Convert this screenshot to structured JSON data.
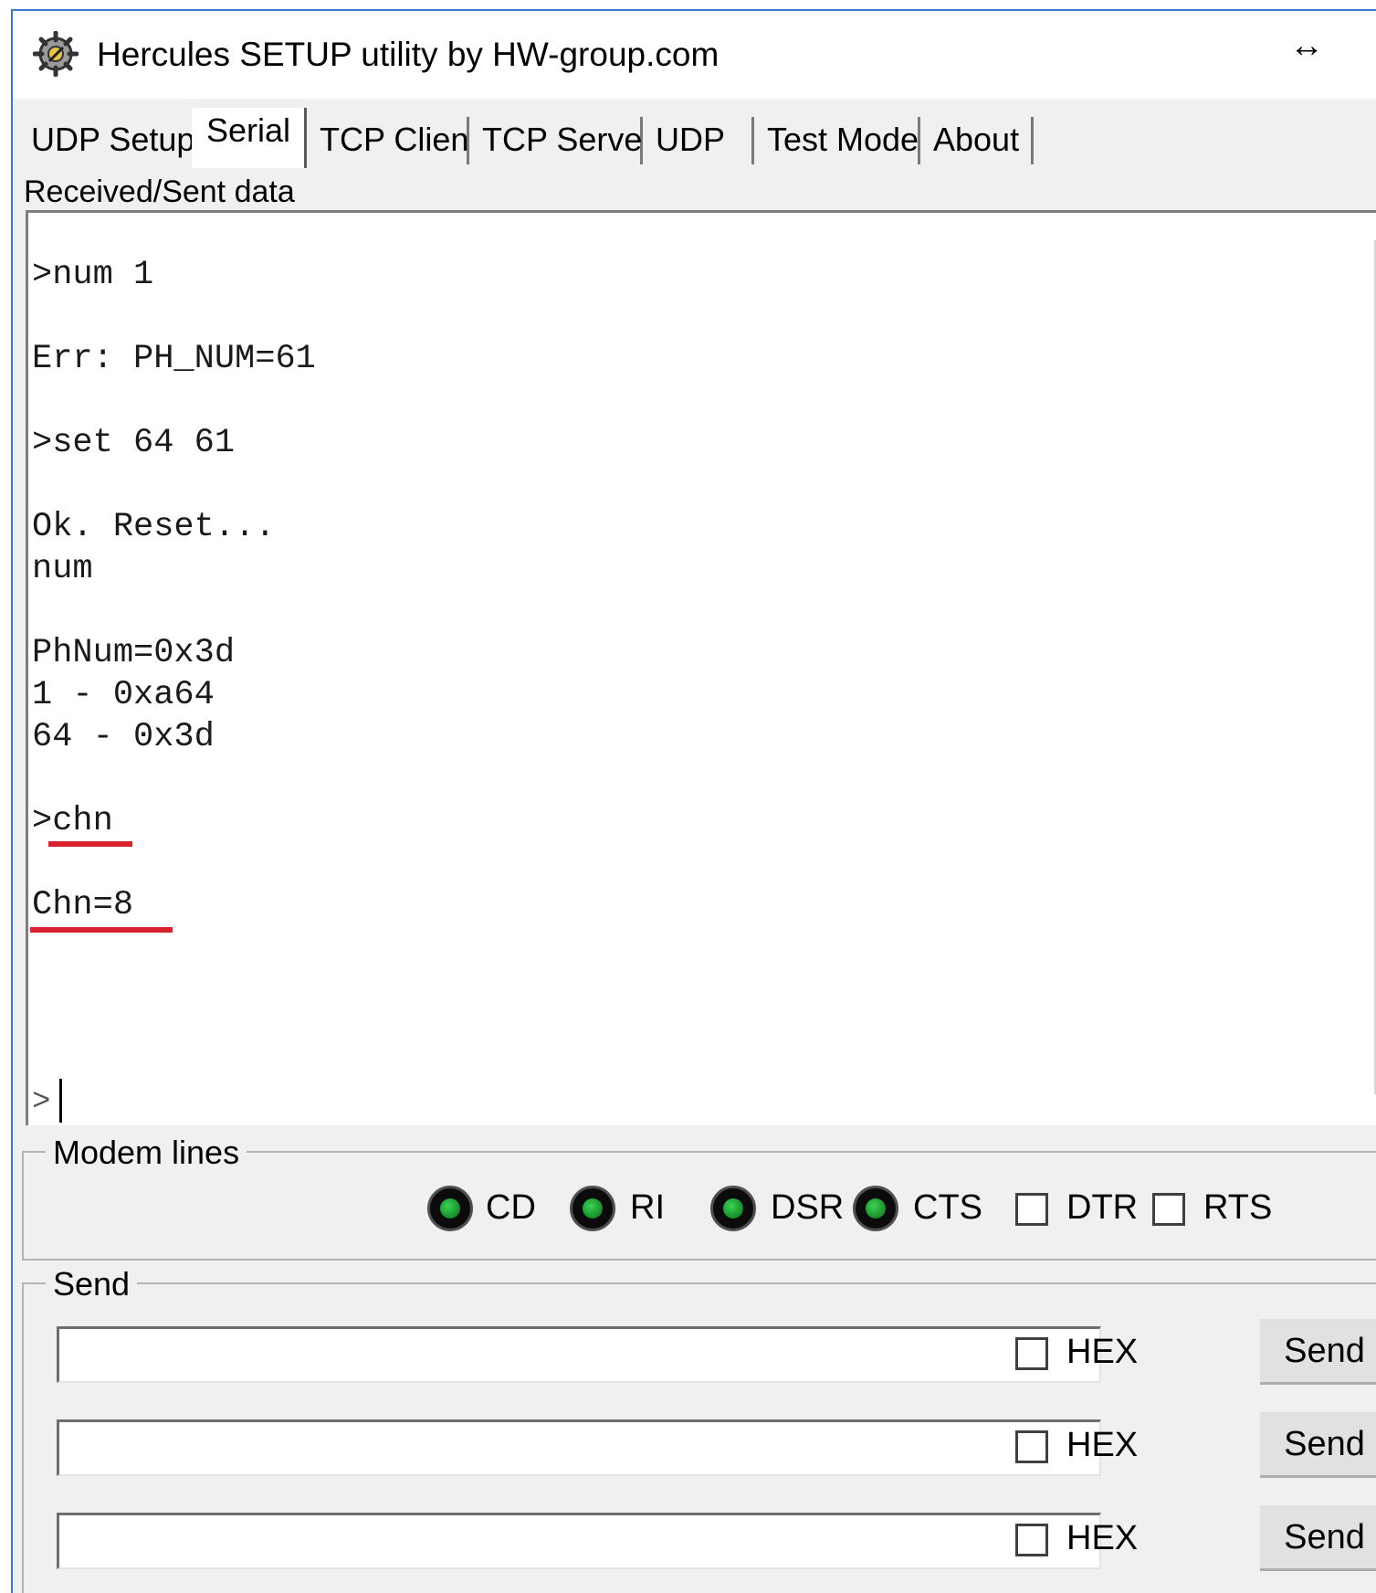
{
  "window": {
    "title": "Hercules SETUP utility by HW-group.com",
    "resize_glyph": "↔"
  },
  "tabs": [
    {
      "label": "UDP Setup",
      "active": false
    },
    {
      "label": "Serial",
      "active": true
    },
    {
      "label": "TCP Client",
      "active": false
    },
    {
      "label": "TCP Server",
      "active": false
    },
    {
      "label": "UDP",
      "active": false
    },
    {
      "label": "Test Mode",
      "active": false
    },
    {
      "label": "About",
      "active": false
    }
  ],
  "received": {
    "label": "Received/Sent data",
    "lines": [
      ">num 1",
      "Err: PH_NUM=61",
      ">set 64 61",
      "Ok. Reset...",
      "num",
      "PhNum=0x3d",
      "1 - 0xa64",
      "64 - 0x3d",
      ">chn",
      "Chn=8",
      ">"
    ],
    "highlight_color": "#d8202f"
  },
  "modem_lines": {
    "label": "Modem lines",
    "indicators": [
      {
        "label": "CD",
        "led_color": "#1d9c33"
      },
      {
        "label": "RI",
        "led_color": "#1d9c33"
      },
      {
        "label": "DSR",
        "led_color": "#1d9c33"
      },
      {
        "label": "CTS",
        "led_color": "#1d9c33"
      }
    ],
    "controls": [
      {
        "label": "DTR",
        "checked": false
      },
      {
        "label": "RTS",
        "checked": false
      }
    ]
  },
  "send": {
    "label": "Send",
    "rows": [
      {
        "value": "",
        "hex_label": "HEX",
        "hex_checked": false,
        "button_label": "Send"
      },
      {
        "value": "",
        "hex_label": "HEX",
        "hex_checked": false,
        "button_label": "Send"
      },
      {
        "value": "",
        "hex_label": "HEX",
        "hex_checked": false,
        "button_label": "Send"
      }
    ]
  }
}
